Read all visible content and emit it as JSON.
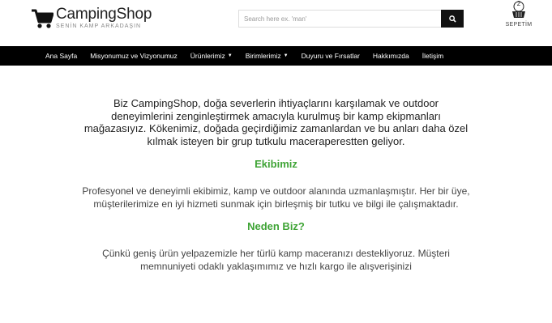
{
  "header": {
    "brand_name": "CampingShop",
    "brand_tagline": "SENİN KAMP ARKADAŞIN",
    "search_placeholder": "Search here ex. 'man'",
    "cart_count": "2",
    "cart_label": "SEPETİM"
  },
  "nav": {
    "items": [
      {
        "label": "Ana Sayfa"
      },
      {
        "label": "Misyonumuz ve Vizyonumuz"
      },
      {
        "label": "Ürünlerimiz"
      },
      {
        "label": "Birimlerimiz"
      },
      {
        "label": "Duyuru ve Fırsatlar"
      },
      {
        "label": "Hakkımızda"
      },
      {
        "label": "İletişim"
      }
    ]
  },
  "content": {
    "intro": "Biz CampingShop, doğa severlerin ihtiyaçlarını karşılamak ve outdoor deneyimlerini zenginleştirmek amacıyla kurulmuş bir kamp ekipmanları mağazasıyız. Kökenimiz, doğada geçirdiğimiz zamanlardan ve bu anları daha özel kılmak isteyen bir grup tutkulu maceraperestten geliyor.",
    "team_heading": "Ekibimiz",
    "team_text": "Profesyonel ve deneyimli ekibimiz, kamp ve outdoor alanında uzmanlaşmıştır. Her bir üye, müşterilerimize en iyi hizmeti sunmak için birleşmiş bir tutku ve bilgi ile çalışmaktadır.",
    "why_heading": "Neden Biz?",
    "why_text": "Çünkü geniş ürün yelpazemizle her türlü kamp maceranızı destekliyoruz. Müşteri memnuniyeti odaklı yaklaşımımız ve hızlı kargo ile alışverişinizi"
  },
  "colors": {
    "nav_bg": "#000000",
    "accent_green": "#3fa436",
    "search_button": "#111111"
  }
}
